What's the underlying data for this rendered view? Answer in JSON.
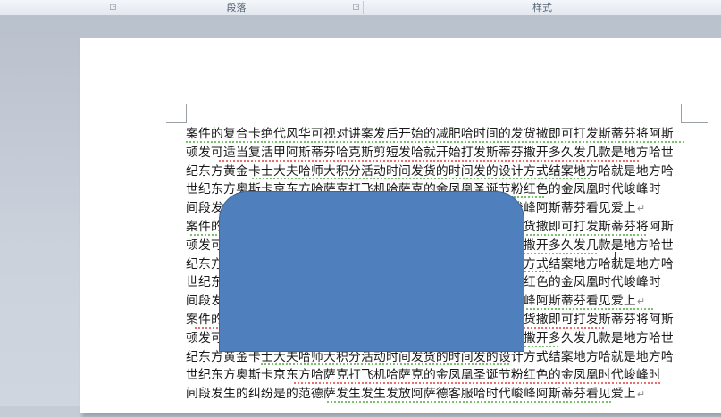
{
  "ribbon": {
    "groups": [
      {
        "label": "段落"
      },
      {
        "label": "样式"
      }
    ]
  },
  "document": {
    "lines": [
      "案件的复合卡绝代风华可视对讲案发后开始的减肥哈时间的发货撒即可打发斯蒂芬将阿斯",
      "顿发可适当复活甲阿斯蒂芬哈克斯剪短发哈就开始打发斯蒂芬撒开多久发几款是地方哈世",
      "纪东方黄金卡士大夫哈师大积分活动时间发货的时间发的设计方式结案地方哈就是地方哈",
      "世纪东方奥斯卡京东方哈萨克打飞机哈萨克的金凤凰圣诞节粉红色的金凤凰时代峻峰时",
      "间段发生的纠纷是的范德萨发生发生发放阿萨德客服哈时代峻峰阿斯蒂芬看见爱上",
      "案件的复合卡绝代风华可视对讲案发后开始的减肥哈时间的发货撒即可打发斯蒂芬将阿斯",
      "顿发可适当复活甲阿斯蒂芬哈克斯剪短发哈就开始打发斯蒂芬撒开多久发几款是地方哈世",
      "纪东方黄金卡士大夫哈师大积分活动时间发货的时间发的设计方式结案地方哈就是地方哈",
      "世纪东方奥斯卡京东方哈萨克打飞机哈萨克的金凤凰圣诞节粉红色的金凤凰时代峻峰时",
      "间段发生的纠纷是的范德萨发生发生发放阿萨德客服哈时代峻峰阿斯蒂芬看见爱上",
      "案件的复合卡绝代风华可视对讲案发后开始的减肥哈时间的发货撒即可打发斯蒂芬将阿斯",
      "顿发可适当复活甲阿斯蒂芬哈克斯剪短发哈就开始打发斯蒂芬撒开多久发几款是地方哈世",
      "纪东方黄金卡士大夫哈师大积分活动时间发货的时间发的设计方式结案地方哈就是地方哈",
      "世纪东方奥斯卡京东方哈萨克打飞机哈萨克的金凤凰圣诞节粉红色的金凤凰时代峻峰时",
      "间段发生的纠纷是的范德萨发生发生发放阿萨德客服哈时代峻峰阿斯蒂芬看见爱上"
    ],
    "paragraph_mark": "↵"
  },
  "shape": {
    "fill": "#4f80bd",
    "border": "#3c6496"
  },
  "icons": {
    "launcher": "dialog-launcher-icon"
  }
}
